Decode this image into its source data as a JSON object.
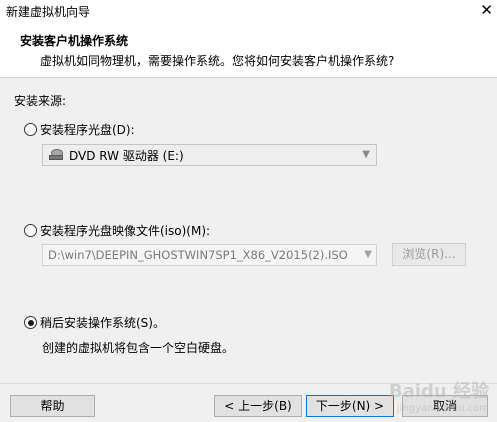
{
  "window": {
    "title": "新建虚拟机向导",
    "close_glyph": "✕"
  },
  "header": {
    "title": "安装客户机操作系统",
    "subtitle": "虚拟机如同物理机，需要操作系统。您将如何安装客户机操作系统?"
  },
  "source": {
    "label": "安装来源:",
    "options": [
      {
        "label": "安装程序光盘(D):",
        "selected": false
      },
      {
        "label": "安装程序光盘映像文件(iso)(M):",
        "selected": false
      },
      {
        "label": "稍后安装操作系统(S)。",
        "selected": true
      }
    ],
    "disc_drive": {
      "value": "DVD RW 驱动器 (E:)",
      "icon": "optical-drive-icon"
    },
    "iso_path": {
      "value": "D:\\win7\\DEEPIN_GHOSTWIN7SP1_X86_V2015(2).ISO"
    },
    "browse_label": "浏览(R)...",
    "later_description": "创建的虚拟机将包含一个空白硬盘。"
  },
  "footer": {
    "help_label": "帮助",
    "back_label": "< 上一步(B)",
    "next_label": "下一步(N) >",
    "cancel_label": "取消"
  },
  "watermark": {
    "text": "Baidu 经验",
    "sub": "jingyan.baidu.com"
  },
  "colors": {
    "accent": "#0078d7",
    "background": "#f0f0f0"
  }
}
